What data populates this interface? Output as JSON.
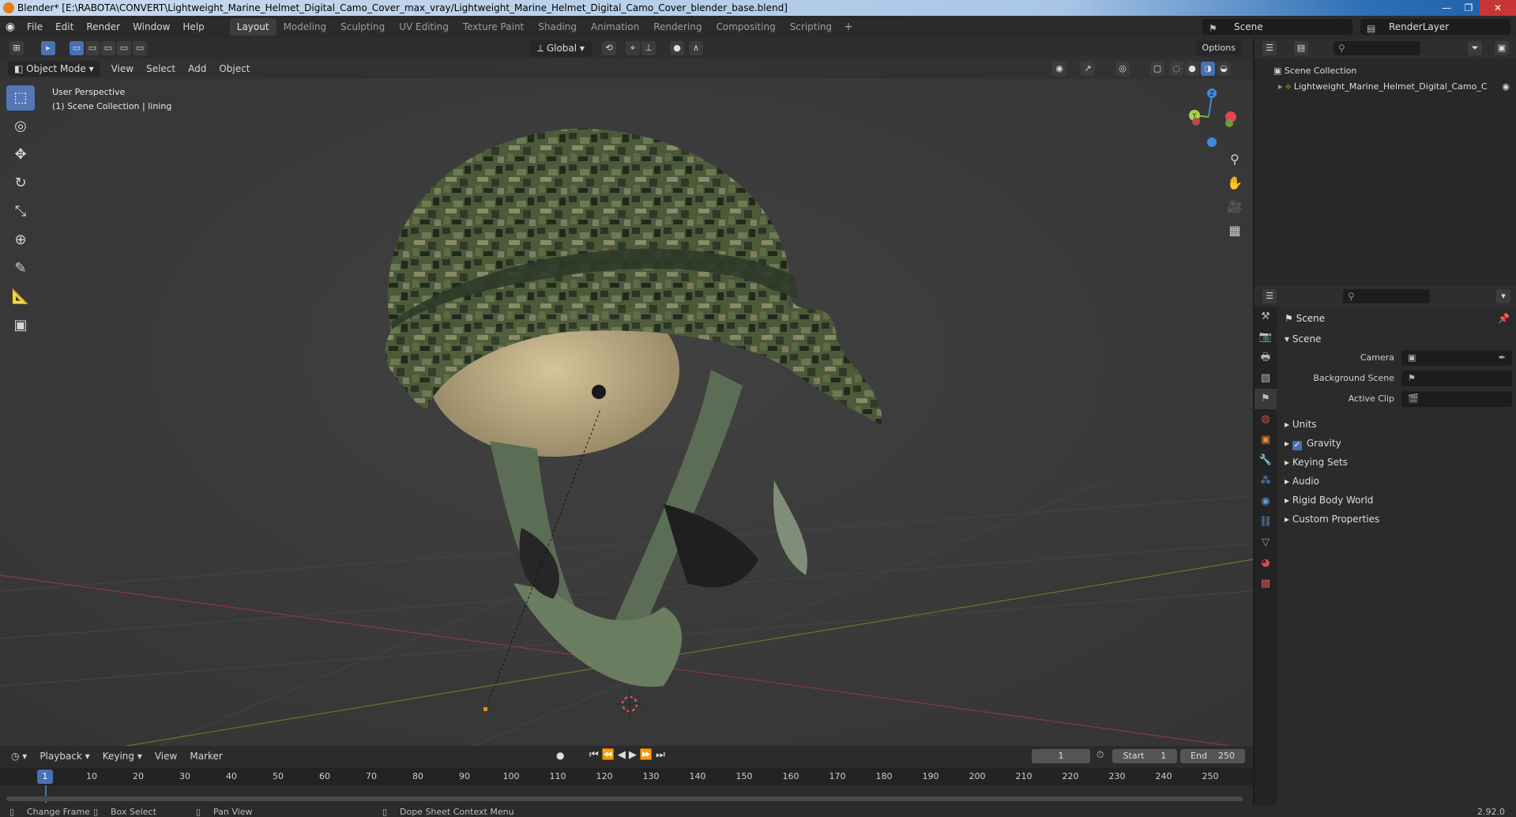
{
  "window": {
    "title": "Blender* [E:\\RABOTA\\CONVERT\\Lightweight_Marine_Helmet_Digital_Camo_Cover_max_vray/Lightweight_Marine_Helmet_Digital_Camo_Cover_blender_base.blend]",
    "minimize": "—",
    "maximize": "❐",
    "close": "✕"
  },
  "menu": {
    "items": [
      "File",
      "Edit",
      "Render",
      "Window",
      "Help"
    ],
    "workspaces": [
      "Layout",
      "Modeling",
      "Sculpting",
      "UV Editing",
      "Texture Paint",
      "Shading",
      "Animation",
      "Rendering",
      "Compositing",
      "Scripting"
    ],
    "add": "+",
    "scene": "Scene",
    "render_layer": "RenderLayer"
  },
  "viewport": {
    "mode": "Object Mode",
    "menu": [
      "View",
      "Select",
      "Add",
      "Object"
    ],
    "orientation": "Global",
    "options": "Options",
    "perspective": "User Perspective",
    "collection_info": "(1) Scene Collection | lining",
    "gizmo_axes": [
      "Z",
      "Y",
      "X"
    ]
  },
  "timeline": {
    "menu": [
      "Playback",
      "Keying",
      "View",
      "Marker"
    ],
    "current_frame": "1",
    "start_label": "Start",
    "start": "1",
    "end_label": "End",
    "end": "250",
    "ticks": [
      "1",
      "10",
      "20",
      "30",
      "40",
      "50",
      "60",
      "70",
      "80",
      "90",
      "100",
      "110",
      "120",
      "130",
      "140",
      "150",
      "160",
      "170",
      "180",
      "190",
      "200",
      "210",
      "220",
      "230",
      "240",
      "250"
    ]
  },
  "statusbar": {
    "change_frame": "Change Frame",
    "box_select": "Box Select",
    "pan_view": "Pan View",
    "context_menu": "Dope Sheet Context Menu",
    "version": "2.92.0"
  },
  "outliner": {
    "root": "Scene Collection",
    "object": "Lightweight_Marine_Helmet_Digital_Camo_C"
  },
  "properties": {
    "title": "Scene",
    "panel": "Scene",
    "camera_label": "Camera",
    "background_label": "Background Scene",
    "clip_label": "Active Clip",
    "sections": [
      "Units",
      "Gravity",
      "Keying Sets",
      "Audio",
      "Rigid Body World",
      "Custom Properties"
    ]
  },
  "colors": {
    "accent": "#4772b3",
    "x_axis": "#e0474e",
    "y_axis": "#7dbb2d",
    "z_axis": "#3d8ae0"
  }
}
